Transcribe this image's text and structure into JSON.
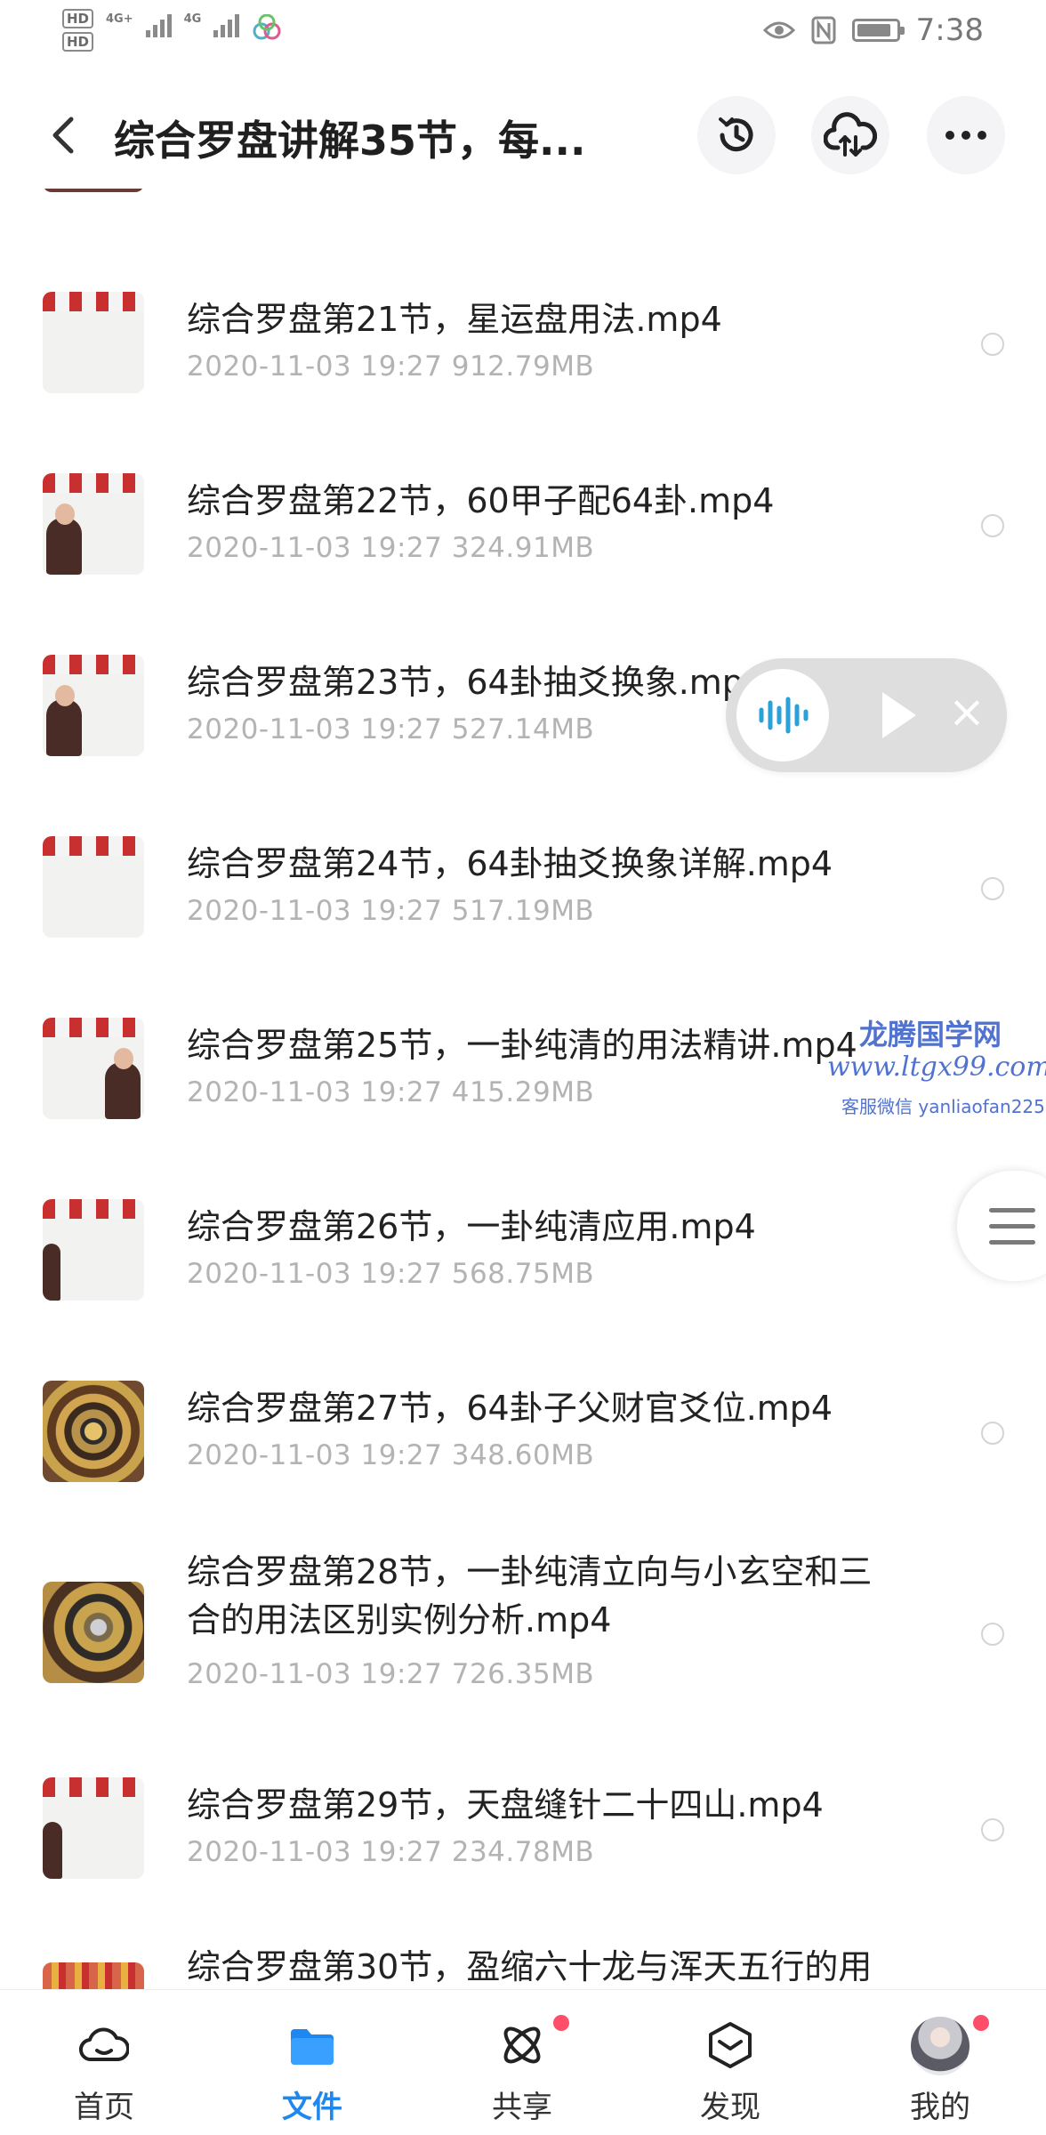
{
  "status_bar": {
    "hd1": "HD",
    "hd2": "HD",
    "net1": "4G+",
    "net2": "4G",
    "time": "7:38"
  },
  "header": {
    "title": "综合罗盘讲解35节，每...",
    "back_icon": "chevron-left-icon",
    "actions": [
      "history-icon",
      "cloud-upload-icon",
      "more-icon"
    ]
  },
  "files": [
    {
      "name": "综合罗盘第21节，星运盘用法.mp4",
      "date": "2020-11-03  19:27",
      "size": "912.79MB",
      "thumb": "whiteboard"
    },
    {
      "name": "综合罗盘第22节，60甲子配64卦.mp4",
      "date": "2020-11-03  19:27",
      "size": "324.91MB",
      "thumb": "whiteboard-person"
    },
    {
      "name": "综合罗盘第23节，64卦抽爻换象.mp4",
      "date": "2020-11-03  19:27",
      "size": "527.14MB",
      "thumb": "whiteboard-person"
    },
    {
      "name": "综合罗盘第24节，64卦抽爻换象详解.mp4",
      "date": "2020-11-03  19:27",
      "size": "517.19MB",
      "thumb": "whiteboard"
    },
    {
      "name": "综合罗盘第25节，一卦纯清的用法精讲.mp4",
      "date": "2020-11-03  19:27",
      "size": "415.29MB",
      "thumb": "whiteboard-person"
    },
    {
      "name": "综合罗盘第26节，一卦纯清应用.mp4",
      "date": "2020-11-03  19:27",
      "size": "568.75MB",
      "thumb": "whiteboard-person"
    },
    {
      "name": "综合罗盘第27节，64卦子父财官爻位.mp4",
      "date": "2020-11-03  19:27",
      "size": "348.60MB",
      "thumb": "compass"
    },
    {
      "name": "综合罗盘第28节，一卦纯清立向与小玄空和三",
      "name2": "合的用法区别实例分析.mp4",
      "date": "2020-11-03  19:27",
      "size": "726.35MB",
      "thumb": "compass2"
    },
    {
      "name": "综合罗盘第29节，天盘缝针二十四山.mp4",
      "date": "2020-11-03  19:27",
      "size": "234.78MB",
      "thumb": "whiteboard-person"
    },
    {
      "name": "综合罗盘第30节，盈缩六十龙与浑天五行的用",
      "date": "",
      "size": "",
      "thumb": "whiteboard"
    }
  ],
  "player": {
    "wave_icon": "audio-wave-icon",
    "play_icon": "play-icon",
    "close_icon": "close-icon"
  },
  "watermark": {
    "line1": "龙腾国学网",
    "line2": "www.ltgx99.com",
    "line3": "客服微信 yanliaofan225"
  },
  "bottom_nav": [
    {
      "label": "首页",
      "icon": "cloud-home-icon",
      "active": false,
      "badge": false
    },
    {
      "label": "文件",
      "icon": "folder-icon",
      "active": true,
      "badge": false
    },
    {
      "label": "共享",
      "icon": "share-atom-icon",
      "active": false,
      "badge": true
    },
    {
      "label": "发现",
      "icon": "discover-box-icon",
      "active": false,
      "badge": false
    },
    {
      "label": "我的",
      "icon": "avatar",
      "active": false,
      "badge": true
    }
  ],
  "colors": {
    "accent": "#1e88f0",
    "meta_text": "#b3b3b3",
    "badge": "#ff4d6a",
    "watermark": "#3f63c9"
  }
}
